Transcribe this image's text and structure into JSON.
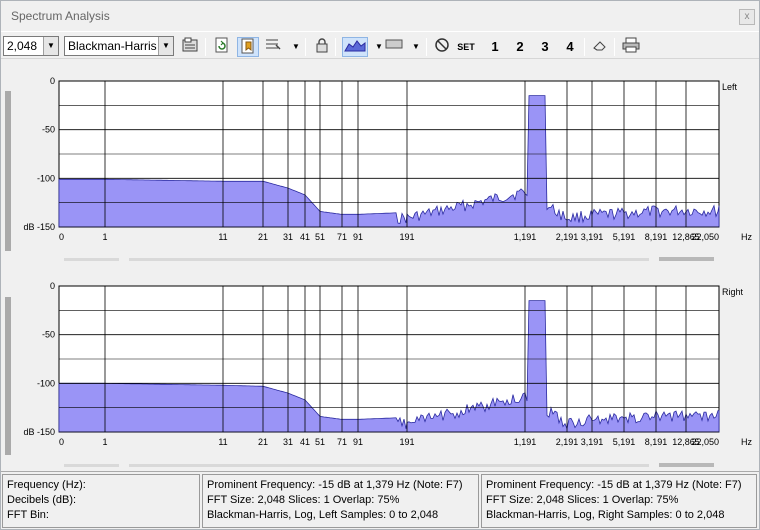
{
  "window": {
    "title": "Spectrum Analysis",
    "close_label": "x"
  },
  "toolbar": {
    "fft_size": "2,048",
    "window_function": "Blackman-Harris",
    "set_label": "SET",
    "preset_1": "1",
    "preset_2": "2",
    "preset_3": "3",
    "preset_4": "4"
  },
  "icons": [
    "properties-icon",
    "refresh-icon",
    "bookmark-icon",
    "scan-icon",
    "lock-icon",
    "area-graph-icon",
    "display-mode-icon",
    "no-icon",
    "eraser-icon",
    "print-icon"
  ],
  "colors": {
    "spectrum_fill": "#9a94f6",
    "spectrum_stroke": "#2a2aa0",
    "grid": "#000000",
    "plot_bg": "#ffffff"
  },
  "axes": {
    "y_ticks": [
      "0",
      "-50",
      "-100",
      "dB -150"
    ],
    "x_ticks": [
      "0",
      "1",
      "11",
      "21",
      "31",
      "41",
      "51",
      "71",
      "91",
      "191",
      "1,191",
      "2,191",
      "3,191",
      "5,191",
      "8,191",
      "12,865",
      "22,050"
    ],
    "x_unit": "Hz"
  },
  "channels": [
    {
      "name": "Left"
    },
    {
      "name": "Right"
    }
  ],
  "chart_data": [
    {
      "type": "area",
      "title": "Left",
      "xlabel": "Hz",
      "ylabel": "dB",
      "ylim": [
        -150,
        0
      ],
      "x_scale": "log",
      "x": [
        "0",
        "1",
        "11",
        "21",
        "31",
        "41",
        "51",
        "71",
        "91",
        "191",
        "1,191",
        "2,191",
        "3,191",
        "5,191",
        "8,191",
        "12,865",
        "22,050"
      ],
      "peak": {
        "frequency_hz": 1379,
        "db": -15
      },
      "grid": true,
      "series": [
        {
          "points_db": [
            -101,
            -101,
            -103,
            -103,
            -110,
            -117,
            -134,
            -137,
            -137,
            -135,
            -108,
            -135,
            -132,
            -130,
            -128,
            -127,
            -128
          ]
        }
      ]
    },
    {
      "type": "area",
      "title": "Right",
      "xlabel": "Hz",
      "ylabel": "dB",
      "ylim": [
        -150,
        0
      ],
      "x_scale": "log",
      "x": [
        "0",
        "1",
        "11",
        "21",
        "31",
        "41",
        "51",
        "71",
        "91",
        "191",
        "1,191",
        "2,191",
        "3,191",
        "5,191",
        "8,191",
        "12,865",
        "22,050"
      ],
      "peak": {
        "frequency_hz": 1379,
        "db": -15
      },
      "grid": true,
      "series": [
        {
          "points_db": [
            -100,
            -100,
            -102,
            -103,
            -110,
            -117,
            -134,
            -137,
            -137,
            -135,
            -108,
            -135,
            -132,
            -130,
            -128,
            -127,
            -128
          ]
        }
      ]
    }
  ],
  "status": {
    "cursor": {
      "frequency": "Frequency (Hz):",
      "decibels": "Decibels (dB):",
      "fft_bin": "FFT Bin:"
    },
    "left": {
      "line1": "Prominent Frequency: -15 dB at 1,379 Hz (Note: F7)",
      "line2": "FFT Size: 2,048  Slices: 1  Overlap: 75%",
      "line3": "Blackman-Harris, Log, Left  Samples: 0 to 2,048"
    },
    "right": {
      "line1": "Prominent Frequency: -15 dB at 1,379 Hz (Note: F7)",
      "line2": "FFT Size: 2,048  Slices: 1  Overlap: 75%",
      "line3": "Blackman-Harris, Log, Right  Samples: 0 to 2,048"
    }
  }
}
